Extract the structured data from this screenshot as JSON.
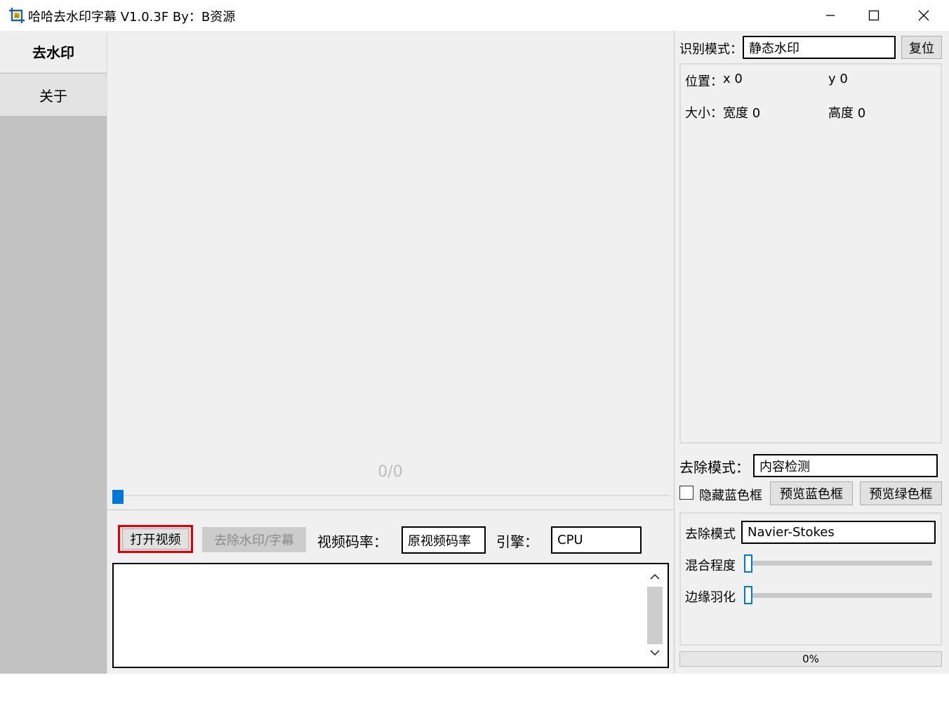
{
  "window": {
    "title": "哈哈去水印字幕 V1.0.3F  By：B资源",
    "minimize_icon": "minimize-icon",
    "maximize_icon": "maximize-icon",
    "close_icon": "close-icon"
  },
  "sidebar": {
    "items": [
      {
        "label": "去水印",
        "active": true
      },
      {
        "label": "关于",
        "active": false
      }
    ]
  },
  "preview": {
    "frame_counter": "0/0",
    "seek_position": 0
  },
  "controls": {
    "open_video_label": "打开视频",
    "remove_label": "去除水印/字幕",
    "bitrate_label": "视频码率：",
    "bitrate_value": "原视频码率",
    "engine_label": "引擎：",
    "engine_value": "CPU",
    "log_text": ""
  },
  "right_panel": {
    "detect_mode_label": "识别模式：",
    "detect_mode_value": "静态水印",
    "reset_label": "复位",
    "position_label": "位置：",
    "x_label": "x 0",
    "y_label": "y 0",
    "size_label": "大小：",
    "width_label": "宽度 0",
    "height_label": "高度 0",
    "remove_mode_label": "去除模式：",
    "remove_mode_value": "内容检测",
    "hide_blue_label": "隐藏蓝色框",
    "hide_blue_checked": false,
    "preview_blue_label": "预览蓝色框",
    "preview_green_label": "预览绿色框",
    "algo_label": "去除模式",
    "algo_value": "Navier-Stokes",
    "blend_label": "混合程度",
    "blend_value": 0,
    "feather_label": "边缘羽化",
    "feather_value": 0,
    "progress_text": "0%"
  },
  "colors": {
    "accent": "#0078d7",
    "highlight": "#e00000",
    "sidebar_bg": "#c2c2c2"
  }
}
